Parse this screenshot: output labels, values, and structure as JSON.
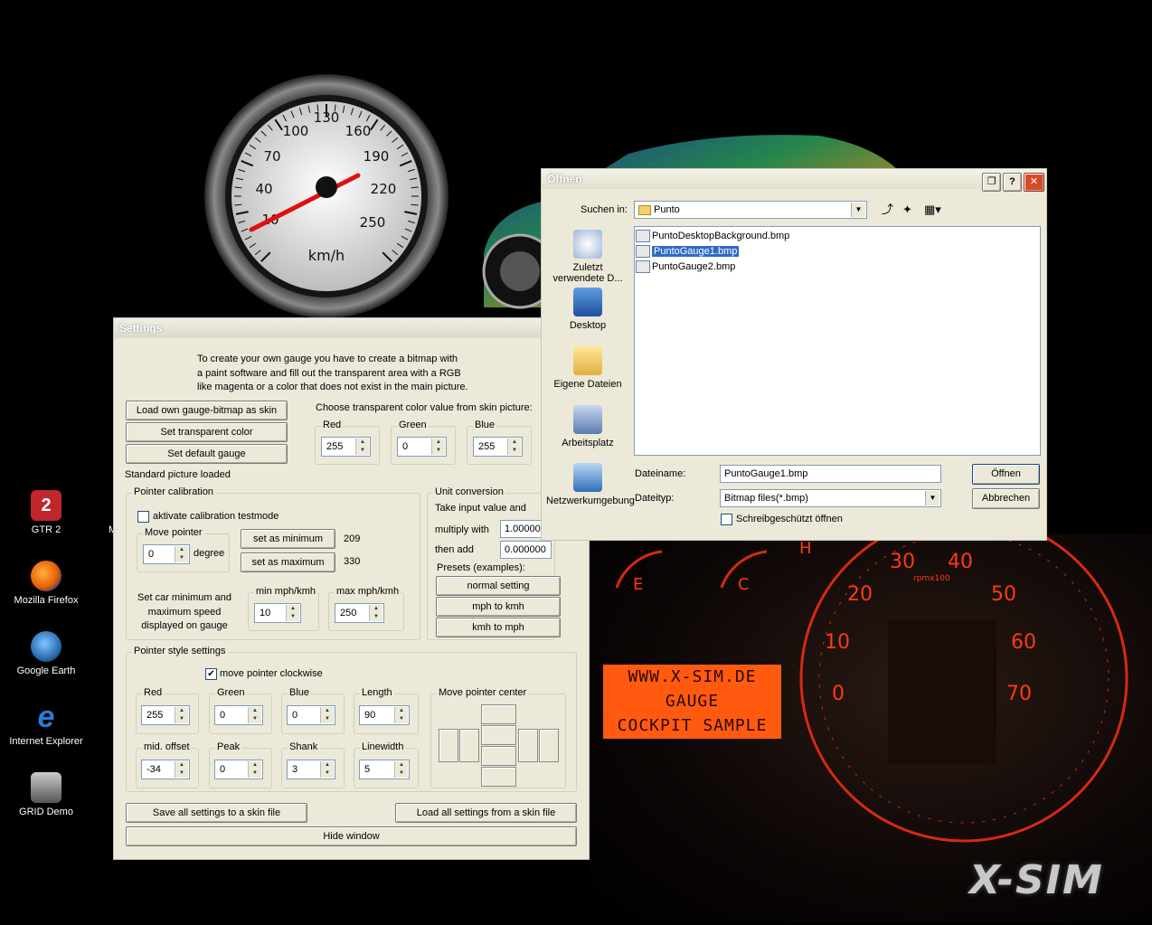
{
  "desktop": {
    "icons": [
      {
        "label": "GTR 2",
        "color": "#c0262c"
      },
      {
        "label": "Mozilla Firefox",
        "color": "#e66000"
      },
      {
        "label": "Google Earth",
        "color": "#2b6cb0"
      },
      {
        "label": "Internet Explorer",
        "color": "#2a7bd4"
      },
      {
        "label": "GRID Demo",
        "color": "#777777"
      }
    ],
    "partial_label": "M"
  },
  "gauge": {
    "ticks": [
      "10",
      "40",
      "70",
      "100",
      "130",
      "160",
      "190",
      "220",
      "250"
    ],
    "unit": "km/h"
  },
  "dashboard": {
    "lcd_lines": [
      "WWW.X-SIM.DE",
      "GAUGE",
      "COCKPIT SAMPLE"
    ],
    "tacho_numbers": [
      "0",
      "10",
      "20",
      "30",
      "40",
      "50",
      "60",
      "70"
    ],
    "tacho_unit": "rpmx100",
    "fuel_letter": "E",
    "temp_letter": "C",
    "hot_letter": "H",
    "logo": "X-SIM"
  },
  "settings": {
    "title": "Settings",
    "intro": [
      "To create your own gauge you have to create a bitmap with",
      "a paint software and fill out the transparent area with a RGB",
      "like magenta or a color that does not exist in the main picture."
    ],
    "load_skin_btn": "Load own gauge-bitmap as skin",
    "set_transparent_btn": "Set transparent color",
    "set_default_btn": "Set default gauge",
    "status": "Standard picture loaded",
    "choose_label": "Choose transparent color value from skin picture:",
    "rgb": {
      "red_label": "Red",
      "red": "255",
      "green_label": "Green",
      "green": "0",
      "blue_label": "Blue",
      "blue": "255"
    },
    "pointer_calibration": {
      "label": "Pointer calibration",
      "testmode": "aktivate calibration testmode",
      "move_pointer": "Move pointer",
      "move_value": "0",
      "degree": "degree",
      "set_min": "set as minimum",
      "min_value": "209",
      "set_max": "set as maximum",
      "max_value": "330",
      "speed_text": [
        "Set car minimum and",
        "maximum speed",
        "displayed on gauge"
      ],
      "min_label": "min mph/kmh",
      "min_speed": "10",
      "max_label": "max mph/kmh",
      "max_speed": "250"
    },
    "unit_conversion": {
      "label": "Unit conversion",
      "take_input": "Take input value and",
      "multiply": "multiply with",
      "multiply_value": "1.00000",
      "then_add": "then add",
      "add_value": "0.000000",
      "presets": "Presets (examples):",
      "normal": "normal setting",
      "mph_kmh": "mph to kmh",
      "kmh_mph": "kmh to mph"
    },
    "pointer_style": {
      "label": "Pointer style settings",
      "clockwise": "move pointer clockwise",
      "red_label": "Red",
      "red": "255",
      "green_label": "Green",
      "green": "0",
      "blue_label": "Blue",
      "blue": "0",
      "length_label": "Length",
      "length": "90",
      "mid_label": "mid. offset",
      "mid": "-34",
      "peak_label": "Peak",
      "peak": "0",
      "shank_label": "Shank",
      "shank": "3",
      "linewidth_label": "Linewidth",
      "linewidth": "5",
      "center_label": "Move pointer center"
    },
    "save_btn": "Save all settings to a skin file",
    "load_btn": "Load all settings from a skin file",
    "hide_btn": "Hide window"
  },
  "open_dialog": {
    "title": "Öffnen",
    "look_in_label": "Suchen in:",
    "look_in_value": "Punto",
    "places": [
      "Zuletzt verwendete D...",
      "Desktop",
      "Eigene Dateien",
      "Arbeitsplatz",
      "Netzwerkumgebung"
    ],
    "files": [
      "PuntoDesktopBackground.bmp",
      "PuntoGauge1.bmp",
      "PuntoGauge2.bmp"
    ],
    "filename_label": "Dateiname:",
    "filename_value": "PuntoGauge1.bmp",
    "filetype_label": "Dateityp:",
    "filetype_value": "Bitmap files(*.bmp)",
    "readonly": "Schreibgeschützt öffnen",
    "open_btn": "Öffnen",
    "cancel_btn": "Abbrechen",
    "help": "?",
    "close": "✕"
  }
}
